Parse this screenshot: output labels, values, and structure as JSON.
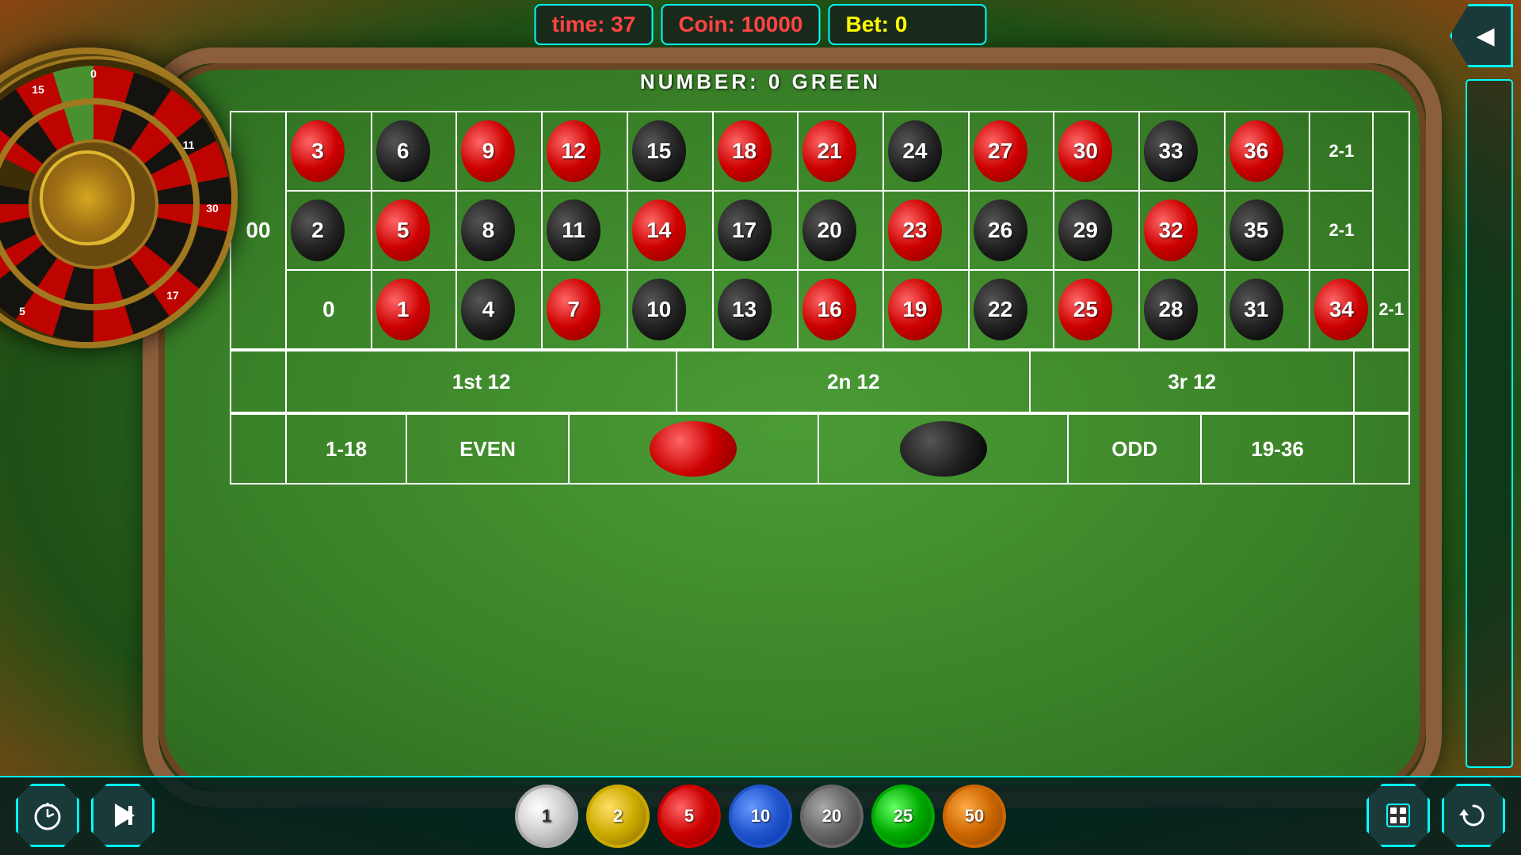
{
  "header": {
    "time_label": "time: 37",
    "coin_label": "Coin:  10000",
    "bet_label": "Bet:  0",
    "back_arrow": "◀"
  },
  "number_display": "NUMBER:  0 GREEN",
  "table": {
    "zero": "0",
    "double_zero": "00",
    "two_to_one": "2-1",
    "numbers": [
      {
        "val": 3,
        "color": "red",
        "row": 1,
        "col": 1
      },
      {
        "val": 6,
        "color": "black",
        "row": 1,
        "col": 2
      },
      {
        "val": 9,
        "color": "red",
        "row": 1,
        "col": 3
      },
      {
        "val": 12,
        "color": "red",
        "row": 1,
        "col": 4
      },
      {
        "val": 15,
        "color": "black",
        "row": 1,
        "col": 5
      },
      {
        "val": 18,
        "color": "red",
        "row": 1,
        "col": 6
      },
      {
        "val": 21,
        "color": "red",
        "row": 1,
        "col": 7
      },
      {
        "val": 24,
        "color": "black",
        "row": 1,
        "col": 8
      },
      {
        "val": 27,
        "color": "red",
        "row": 1,
        "col": 9
      },
      {
        "val": 30,
        "color": "red",
        "row": 1,
        "col": 10
      },
      {
        "val": 33,
        "color": "black",
        "row": 1,
        "col": 11
      },
      {
        "val": 36,
        "color": "red",
        "row": 1,
        "col": 12
      },
      {
        "val": 2,
        "color": "black",
        "row": 2,
        "col": 1
      },
      {
        "val": 5,
        "color": "red",
        "row": 2,
        "col": 2
      },
      {
        "val": 8,
        "color": "black",
        "row": 2,
        "col": 3
      },
      {
        "val": 11,
        "color": "black",
        "row": 2,
        "col": 4
      },
      {
        "val": 14,
        "color": "red",
        "row": 2,
        "col": 5
      },
      {
        "val": 17,
        "color": "black",
        "row": 2,
        "col": 6
      },
      {
        "val": 20,
        "color": "black",
        "row": 2,
        "col": 7
      },
      {
        "val": 23,
        "color": "red",
        "row": 2,
        "col": 8
      },
      {
        "val": 26,
        "color": "black",
        "row": 2,
        "col": 9
      },
      {
        "val": 29,
        "color": "black",
        "row": 2,
        "col": 10
      },
      {
        "val": 32,
        "color": "red",
        "row": 2,
        "col": 11
      },
      {
        "val": 35,
        "color": "black",
        "row": 2,
        "col": 12
      },
      {
        "val": 1,
        "color": "red",
        "row": 3,
        "col": 1
      },
      {
        "val": 4,
        "color": "black",
        "row": 3,
        "col": 2
      },
      {
        "val": 7,
        "color": "red",
        "row": 3,
        "col": 3
      },
      {
        "val": 10,
        "color": "black",
        "row": 3,
        "col": 4
      },
      {
        "val": 13,
        "color": "black",
        "row": 3,
        "col": 5
      },
      {
        "val": 16,
        "color": "red",
        "row": 3,
        "col": 6
      },
      {
        "val": 19,
        "color": "red",
        "row": 3,
        "col": 7
      },
      {
        "val": 22,
        "color": "black",
        "row": 3,
        "col": 8
      },
      {
        "val": 25,
        "color": "red",
        "row": 3,
        "col": 9
      },
      {
        "val": 28,
        "color": "black",
        "row": 3,
        "col": 10
      },
      {
        "val": 31,
        "color": "black",
        "row": 3,
        "col": 11
      },
      {
        "val": 34,
        "color": "red",
        "row": 3,
        "col": 12
      }
    ],
    "dozen_bets": [
      "1st 12",
      "2n 12",
      "3r 12"
    ],
    "outside_bets": [
      "1-18",
      "EVEN",
      "",
      "",
      "ODD",
      "19-36"
    ]
  },
  "chips": [
    {
      "value": 1,
      "class": "chip-1"
    },
    {
      "value": 2,
      "class": "chip-2"
    },
    {
      "value": 5,
      "class": "chip-5"
    },
    {
      "value": 10,
      "class": "chip-10"
    },
    {
      "value": 20,
      "class": "chip-20"
    },
    {
      "value": 25,
      "class": "chip-25"
    },
    {
      "value": 50,
      "class": "chip-50"
    }
  ],
  "buttons": {
    "timer": "⏱",
    "pause": "⏸",
    "reset": "↺",
    "bet_action": "◼"
  },
  "colors": {
    "accent": "#00ffff",
    "red": "#cc0000",
    "black": "#111111",
    "green": "#3a8228",
    "gold": "#ccaa00"
  }
}
